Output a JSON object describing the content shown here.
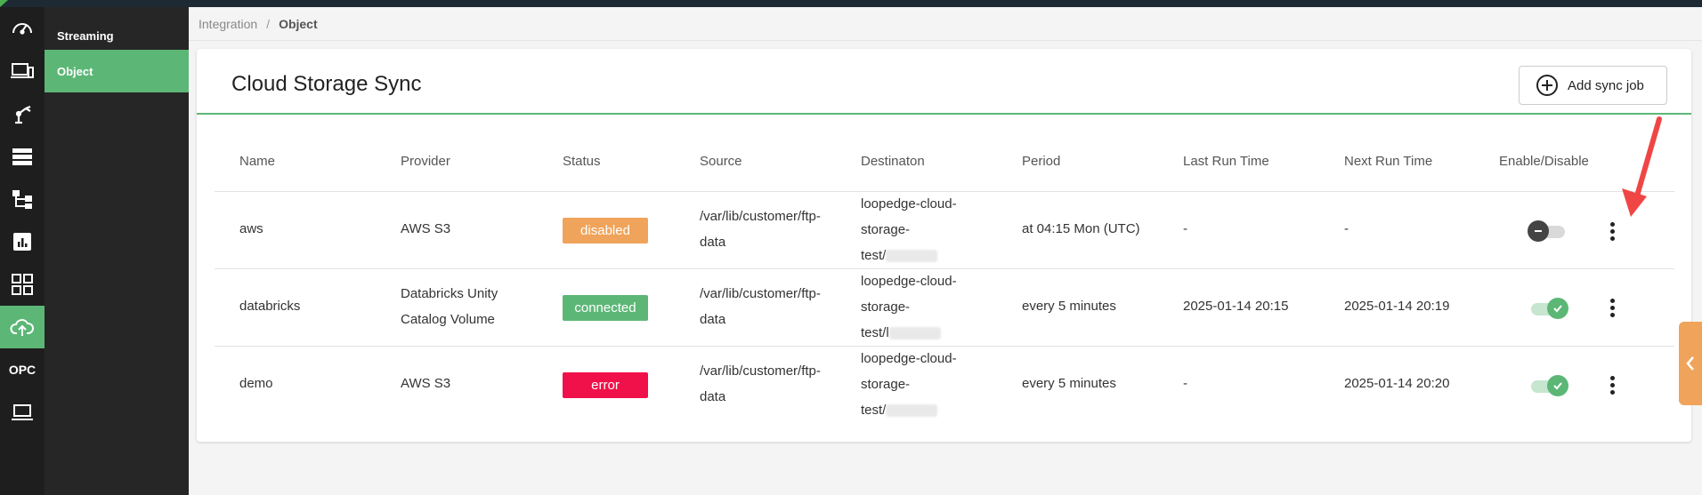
{
  "iconbar": {
    "items": [
      {
        "icon": "dashboard-gauge-icon"
      },
      {
        "icon": "devices-icon"
      },
      {
        "icon": "robot-arm-icon"
      },
      {
        "icon": "server-stack-icon"
      },
      {
        "icon": "flow-diagram-icon"
      },
      {
        "icon": "analytics-chart-icon"
      },
      {
        "icon": "apps-grid-icon"
      },
      {
        "icon": "cloud-upload-icon",
        "active": true
      },
      {
        "label": "OPC"
      },
      {
        "icon": "laptop-icon"
      }
    ]
  },
  "subnav": {
    "items": [
      {
        "label": "Streaming"
      },
      {
        "label": "Object",
        "active": true
      }
    ]
  },
  "breadcrumb": {
    "parent": "Integration",
    "separator": "/",
    "current": "Object"
  },
  "header": {
    "title": "Cloud Storage Sync",
    "add_label": "Add sync job"
  },
  "table": {
    "columns": [
      "Name",
      "Provider",
      "Status",
      "Source",
      "Destinaton",
      "Period",
      "Last Run Time",
      "Next Run Time",
      "Enable/Disable"
    ],
    "rows": [
      {
        "name": "aws",
        "provider": "AWS S3",
        "status": "disabled",
        "source_1": "/var/lib/customer/ftp-",
        "source_2": "data",
        "dest_1": "loopedge-cloud-",
        "dest_2": "storage-",
        "dest_3": "test/",
        "period": "at 04:15 Mon (UTC)",
        "last_run": "-",
        "next_run": "-",
        "enabled": false
      },
      {
        "name": "databricks",
        "provider_1": "Databricks Unity",
        "provider_2": "Catalog Volume",
        "status": "connected",
        "source_1": "/var/lib/customer/ftp-",
        "source_2": "data",
        "dest_1": "loopedge-cloud-",
        "dest_2": "storage-",
        "dest_3": "test/l",
        "period": "every 5 minutes",
        "last_run": "2025-01-14 20:15",
        "next_run": "2025-01-14 20:19",
        "enabled": true
      },
      {
        "name": "demo",
        "provider": "AWS S3",
        "status": "error",
        "source_1": "/var/lib/customer/ftp-",
        "source_2": "data",
        "dest_1": "loopedge-cloud-",
        "dest_2": "storage-",
        "dest_3": "test/",
        "period": "every 5 minutes",
        "last_run": "-",
        "next_run": "2025-01-14 20:20",
        "enabled": true
      }
    ]
  },
  "colors": {
    "accent": "#5cb776",
    "disabled": "#f0a35a",
    "connected": "#5cb776",
    "error": "#f0114a",
    "annotation_arrow": "#f04545"
  }
}
